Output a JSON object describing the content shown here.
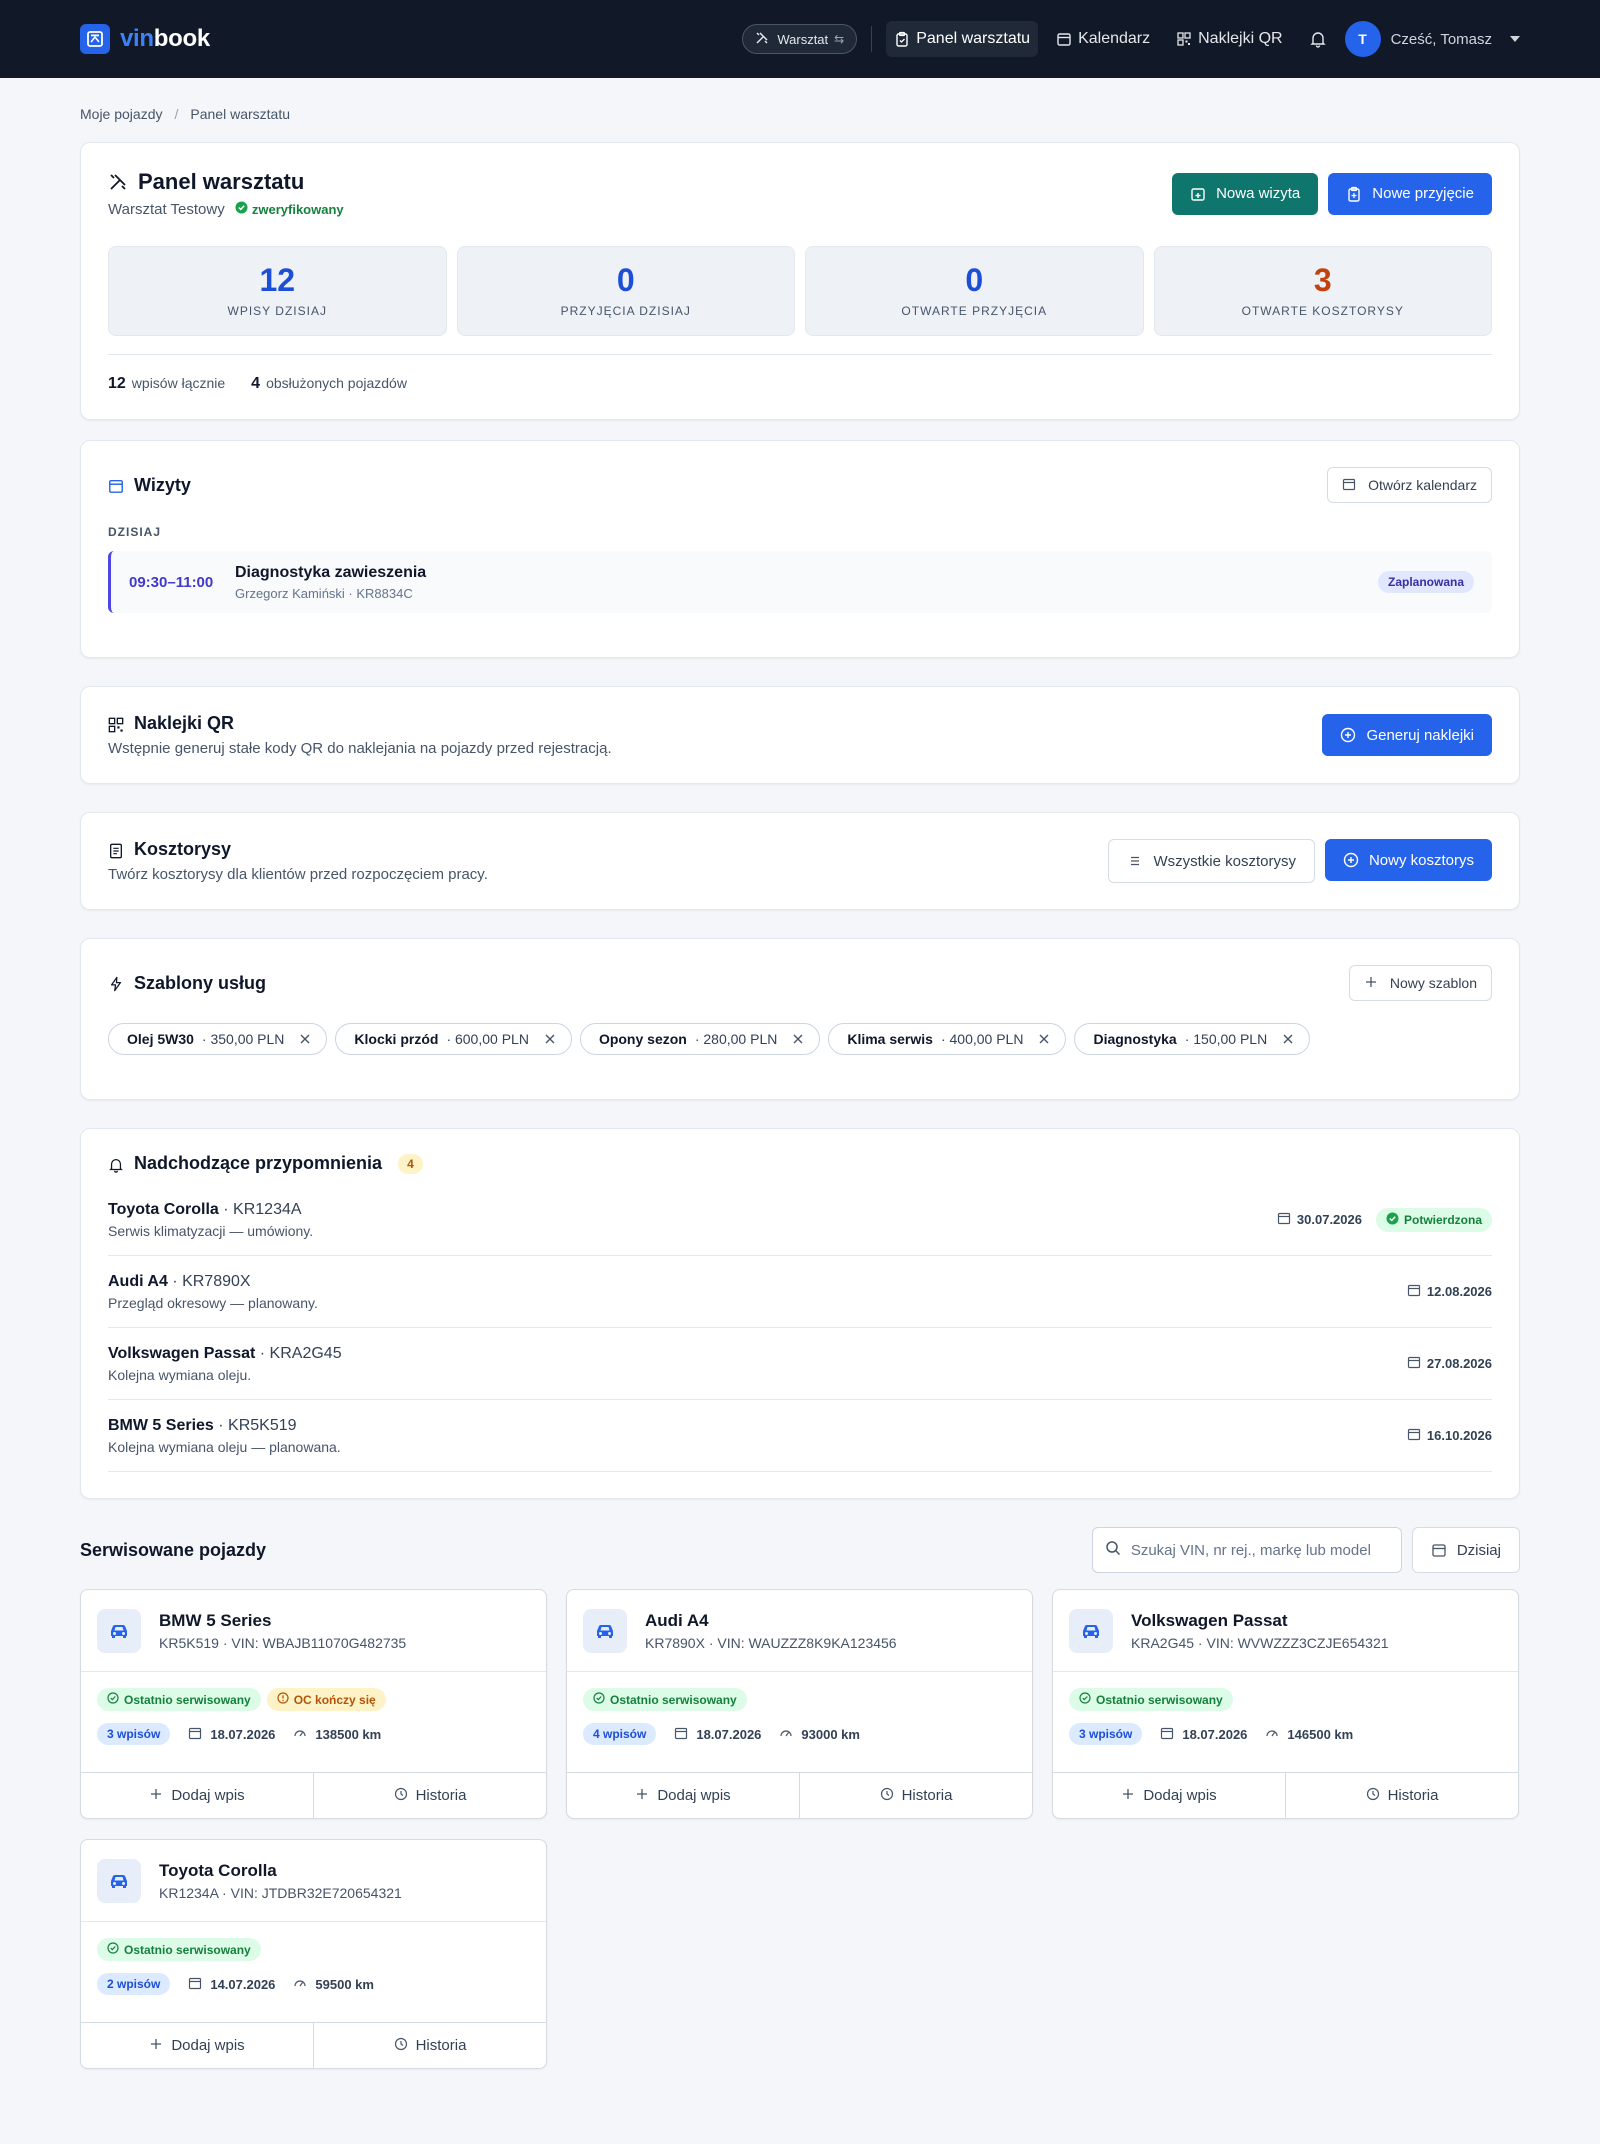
{
  "nav": {
    "brand_a": "vin",
    "brand_b": "book",
    "workshop_pill": "Warsztat",
    "links": [
      {
        "label": "Panel warsztatu",
        "icon": "clipboard-icon"
      },
      {
        "label": "Kalendarz",
        "icon": "calendar-icon"
      },
      {
        "label": "Naklejki QR",
        "icon": "qr-icon"
      }
    ],
    "user_initial": "T",
    "user_greeting": "Cześć, Tomasz"
  },
  "breadcrumb": [
    "Moje pojazdy",
    "Panel warsztatu"
  ],
  "panel": {
    "title": "Panel warsztatu",
    "workshop_name": "Warsztat Testowy",
    "verified": "zweryfikowany",
    "btn_new_visit": "Nowa wizyta",
    "btn_new_intake": "Nowe przyjęcie",
    "stats": [
      {
        "value": "12",
        "label": "WPISY DZISIAJ"
      },
      {
        "value": "0",
        "label": "PRZYJĘCIA DZISIAJ"
      },
      {
        "value": "0",
        "label": "OTWARTE PRZYJĘCIA"
      },
      {
        "value": "3",
        "label": "OTWARTE KOSZTORYSY"
      }
    ],
    "total_entries": "12",
    "total_entries_label": "wpisów łącznie",
    "vehicles_served": "4",
    "vehicles_served_label": "obsłużonych pojazdów"
  },
  "visits": {
    "title": "Wizyty",
    "btn_calendar": "Otwórz kalendarz",
    "today_label": "DZISIAJ",
    "item": {
      "time": "09:30–11:00",
      "title": "Diagnostyka zawieszenia",
      "sub": "Grzegorz Kamiński · KR8834C",
      "status": "Zaplanowana"
    }
  },
  "qr": {
    "title": "Naklejki QR",
    "desc": "Wstępnie generuj stałe kody QR do naklejania na pojazdy przed rejestracją.",
    "btn": "Generuj naklejki"
  },
  "estimates": {
    "title": "Kosztorysy",
    "desc": "Twórz kosztorysy dla klientów przed rozpoczęciem pracy.",
    "btn_all": "Wszystkie kosztorysy",
    "btn_new": "Nowy kosztorys"
  },
  "templates": {
    "title": "Szablony usług",
    "btn_new": "Nowy szablon",
    "items": [
      {
        "name": "Olej 5W30",
        "price": "· 350,00 PLN"
      },
      {
        "name": "Klocki przód",
        "price": "· 600,00 PLN"
      },
      {
        "name": "Opony sezon",
        "price": "· 280,00 PLN"
      },
      {
        "name": "Klima serwis",
        "price": "· 400,00 PLN"
      },
      {
        "name": "Diagnostyka",
        "price": "· 150,00 PLN"
      }
    ]
  },
  "reminders": {
    "title": "Nadchodzące przypomnienia",
    "count": "4",
    "items": [
      {
        "car": "Toyota Corolla",
        "plate": " · KR1234A",
        "desc": "Serwis klimatyzacji — umówiony.",
        "date": "30.07.2026",
        "status": "Potwierdzona"
      },
      {
        "car": "Audi A4",
        "plate": " · KR7890X",
        "desc": "Przegląd okresowy — planowany.",
        "date": "12.08.2026",
        "status": ""
      },
      {
        "car": "Volkswagen Passat",
        "plate": " · KRA2G45",
        "desc": "Kolejna wymiana oleju.",
        "date": "27.08.2026",
        "status": ""
      },
      {
        "car": "BMW 5 Series",
        "plate": " · KR5K519",
        "desc": "Kolejna wymiana oleju — planowana.",
        "date": "16.10.2026",
        "status": ""
      }
    ]
  },
  "vehicles": {
    "title": "Serwisowane pojazdy",
    "search_placeholder": "Szukaj VIN, nr rej., markę lub model",
    "btn_today": "Dzisiaj",
    "add_label": "Dodaj wpis",
    "history_label": "Historia",
    "items": [
      {
        "name": "BMW 5 Series",
        "sub": "KR5K519 · VIN: WBAJB11070G482735",
        "badge1": "Ostatnio serwisowany",
        "badge2": "OC kończy się",
        "entries": "3 wpisów",
        "date": "18.07.2026",
        "km": "138500 km"
      },
      {
        "name": "Audi A4",
        "sub": "KR7890X · VIN: WAUZZZ8K9KA123456",
        "badge1": "Ostatnio serwisowany",
        "badge2": "",
        "entries": "4 wpisów",
        "date": "18.07.2026",
        "km": "93000 km"
      },
      {
        "name": "Volkswagen Passat",
        "sub": "KRA2G45 · VIN: WVWZZZ3CZJE654321",
        "badge1": "Ostatnio serwisowany",
        "badge2": "",
        "entries": "3 wpisów",
        "date": "18.07.2026",
        "km": "146500 km"
      },
      {
        "name": "Toyota Corolla",
        "sub": "KR1234A · VIN: JTDBR32E720654321",
        "badge1": "Ostatnio serwisowany",
        "badge2": "",
        "entries": "2 wpisów",
        "date": "14.07.2026",
        "km": "59500 km"
      }
    ]
  },
  "colors": {
    "navbar": "#111827",
    "primary": "#2563eb",
    "teal": "#0f766e",
    "orange": "#c2410c"
  }
}
